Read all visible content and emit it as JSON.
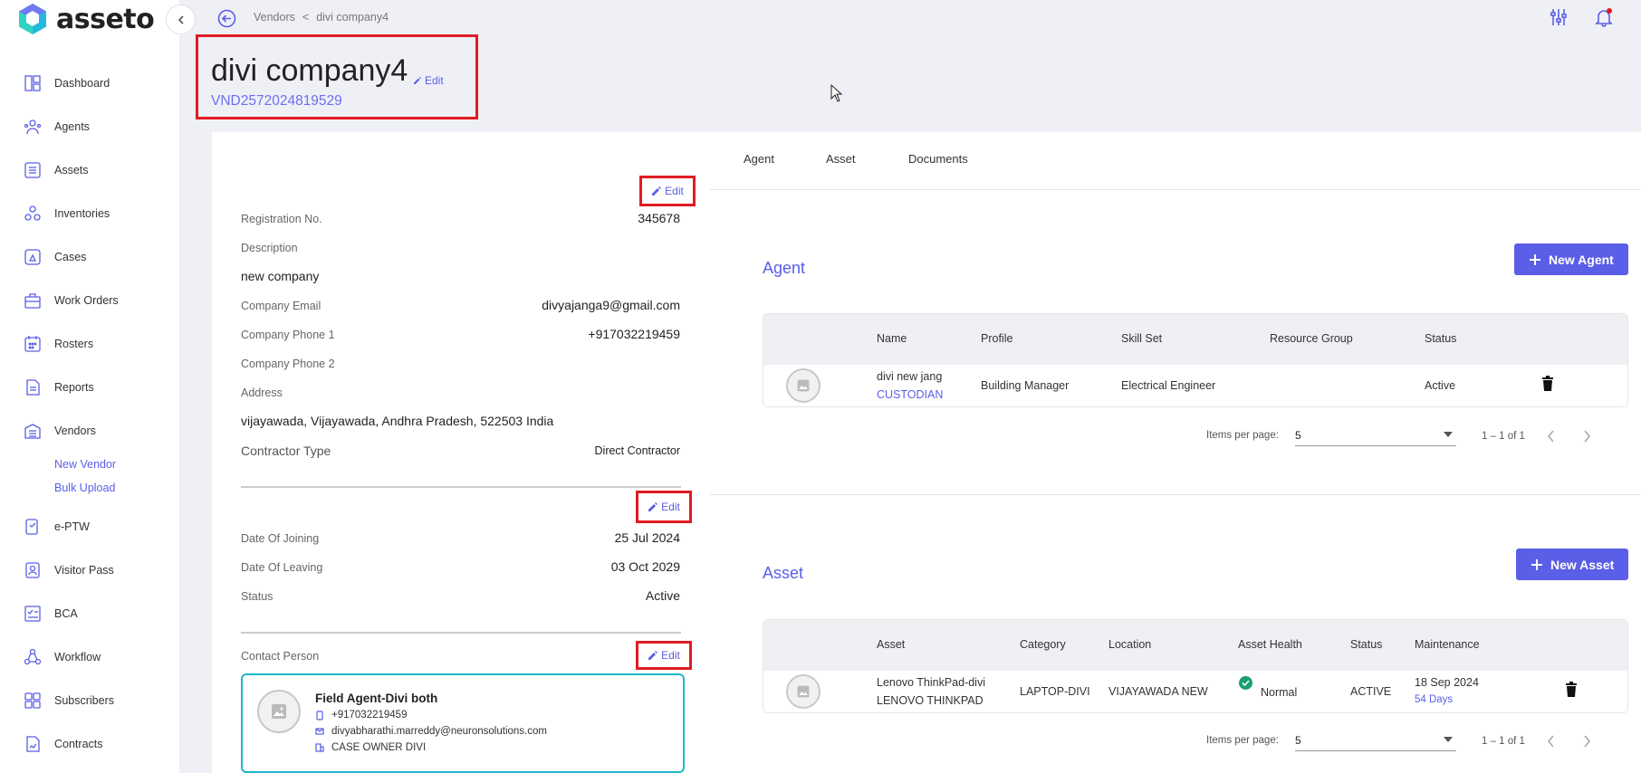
{
  "brand": {
    "name": "asseto"
  },
  "sidebar": {
    "items": [
      {
        "label": "Dashboard",
        "icon": "dashboard-icon"
      },
      {
        "label": "Agents",
        "icon": "agents-icon"
      },
      {
        "label": "Assets",
        "icon": "assets-icon"
      },
      {
        "label": "Inventories",
        "icon": "inventories-icon"
      },
      {
        "label": "Cases",
        "icon": "cases-icon"
      },
      {
        "label": "Work Orders",
        "icon": "work-orders-icon"
      },
      {
        "label": "Rosters",
        "icon": "rosters-icon"
      },
      {
        "label": "Reports",
        "icon": "reports-icon"
      },
      {
        "label": "Vendors",
        "icon": "vendors-icon"
      },
      {
        "label": "e-PTW",
        "icon": "eptw-icon"
      },
      {
        "label": "Visitor Pass",
        "icon": "visitor-pass-icon"
      },
      {
        "label": "BCA",
        "icon": "bca-icon"
      },
      {
        "label": "Workflow",
        "icon": "workflow-icon"
      },
      {
        "label": "Subscribers",
        "icon": "subscribers-icon"
      },
      {
        "label": "Contracts",
        "icon": "contracts-icon"
      }
    ],
    "vendor_sub": [
      "New Vendor",
      "Bulk Upload"
    ]
  },
  "breadcrumb": {
    "parent": "Vendors",
    "separator": "<",
    "current": "divi company4"
  },
  "header": {
    "title": "divi company4",
    "edit_label": "Edit",
    "code": "VND2572024819529"
  },
  "details": {
    "edit_label": "Edit",
    "registration_label": "Registration No.",
    "registration_value": "345678",
    "description_label": "Description",
    "description_value": "new company",
    "email_label": "Company Email",
    "email_value": "divyajanga9@gmail.com",
    "phone1_label": "Company Phone 1",
    "phone1_value": "+917032219459",
    "phone2_label": "Company Phone 2",
    "address_label": "Address",
    "address_value": "vijayawada, Vijayawada, Andhra Pradesh, 522503 India",
    "contractor_label": "Contractor Type",
    "contractor_value": "Direct Contractor"
  },
  "dates": {
    "edit_label": "Edit",
    "joining_label": "Date Of Joining",
    "joining_value": "25 Jul 2024",
    "leaving_label": "Date Of Leaving",
    "leaving_value": "03 Oct 2029",
    "status_label": "Status",
    "status_value": "Active"
  },
  "contact": {
    "label": "Contact Person",
    "edit_label": "Edit",
    "name": "Field Agent-Divi both",
    "phone": "+917032219459",
    "email": "divyabharathi.marreddy@neuronsolutions.com",
    "role": "CASE OWNER DIVI"
  },
  "tabs": [
    "Agent",
    "Asset",
    "Documents"
  ],
  "agent_section": {
    "title": "Agent",
    "button": "New Agent",
    "columns": [
      "Name",
      "Profile",
      "Skill Set",
      "Resource Group",
      "Status"
    ],
    "row": {
      "name": "divi new jang",
      "role": "CUSTODIAN",
      "profile": "Building Manager",
      "skill": "Electrical Engineer",
      "group": "",
      "status": "Active"
    },
    "pager": {
      "label": "Items per page:",
      "size": "5",
      "range": "1 – 1 of 1"
    }
  },
  "asset_section": {
    "title": "Asset",
    "button": "New Asset",
    "columns": [
      "Asset",
      "Category",
      "Location",
      "Asset Health",
      "Status",
      "Maintenance"
    ],
    "row": {
      "name": "Lenovo ThinkPad-divi",
      "model": "LENOVO THINKPAD",
      "category": "LAPTOP-DIVI",
      "location": "VIJAYAWADA NEW",
      "health": "Normal",
      "status": "ACTIVE",
      "maint_date": "18 Sep 2024",
      "maint_days": "54 Days"
    },
    "pager": {
      "label": "Items per page:",
      "size": "5",
      "range": "1 – 1 of 1"
    }
  },
  "colors": {
    "accent": "#5b5ee6",
    "highlight": "#e21b23",
    "contact_border": "#1fb6c9",
    "health_ok": "#1a9e76"
  }
}
